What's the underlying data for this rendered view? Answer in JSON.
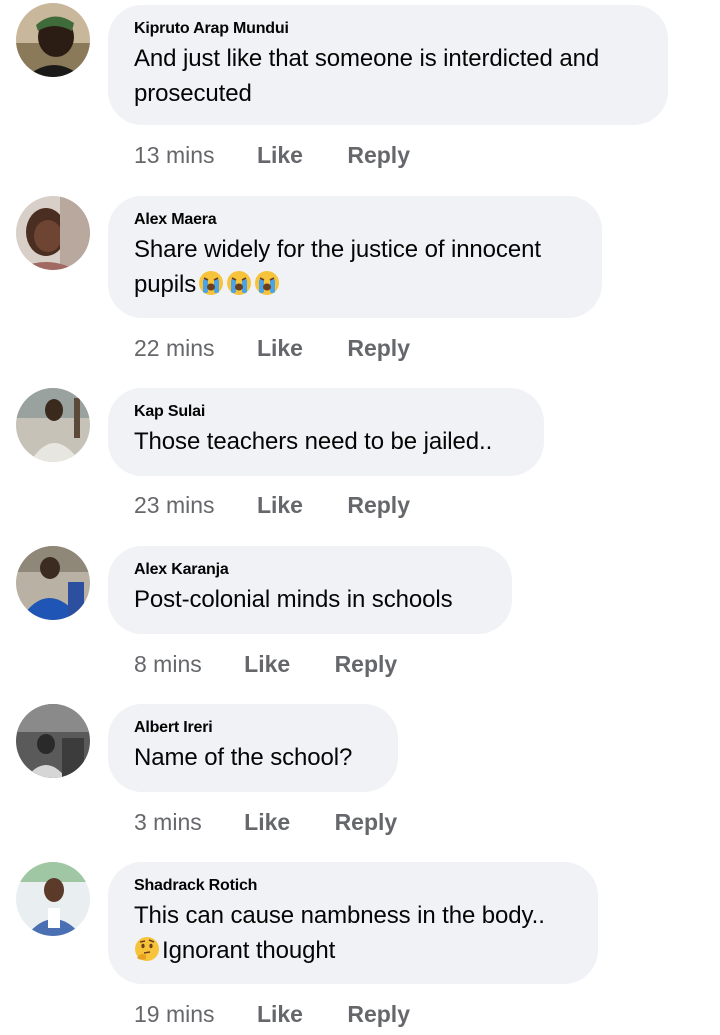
{
  "comments": [
    {
      "author": "Kipruto Arap Mundui",
      "line1": "And just like that someone is interdicted and",
      "line2": "prosecuted",
      "time": "13 mins",
      "like": "Like",
      "reply": "Reply"
    },
    {
      "author": "Alex Maera",
      "line1": "Share widely for the justice of innocent",
      "line2": "pupils",
      "time": "22 mins",
      "like": "Like",
      "reply": "Reply",
      "emoji": "loudly-crying-face"
    },
    {
      "author": "Kap Sulai",
      "line1": "Those teachers need to be jailed..",
      "time": "23 mins",
      "like": "Like",
      "reply": "Reply"
    },
    {
      "author": "Alex Karanja",
      "line1": "Post-colonial minds in schools",
      "time": "8 mins",
      "like": "Like",
      "reply": "Reply"
    },
    {
      "author": "Albert Ireri",
      "line1": "Name of the school?",
      "time": "3 mins",
      "like": "Like",
      "reply": "Reply"
    },
    {
      "author": "Shadrack Rotich",
      "line1": "This can cause nambness in the body..",
      "line2": "Ignorant thought",
      "time": "19 mins",
      "like": "Like",
      "reply": "Reply",
      "emoji": "thinking-face"
    }
  ],
  "colors": {
    "bubble": "#f0f2f5",
    "meta": "#65676b",
    "text": "#050505"
  }
}
